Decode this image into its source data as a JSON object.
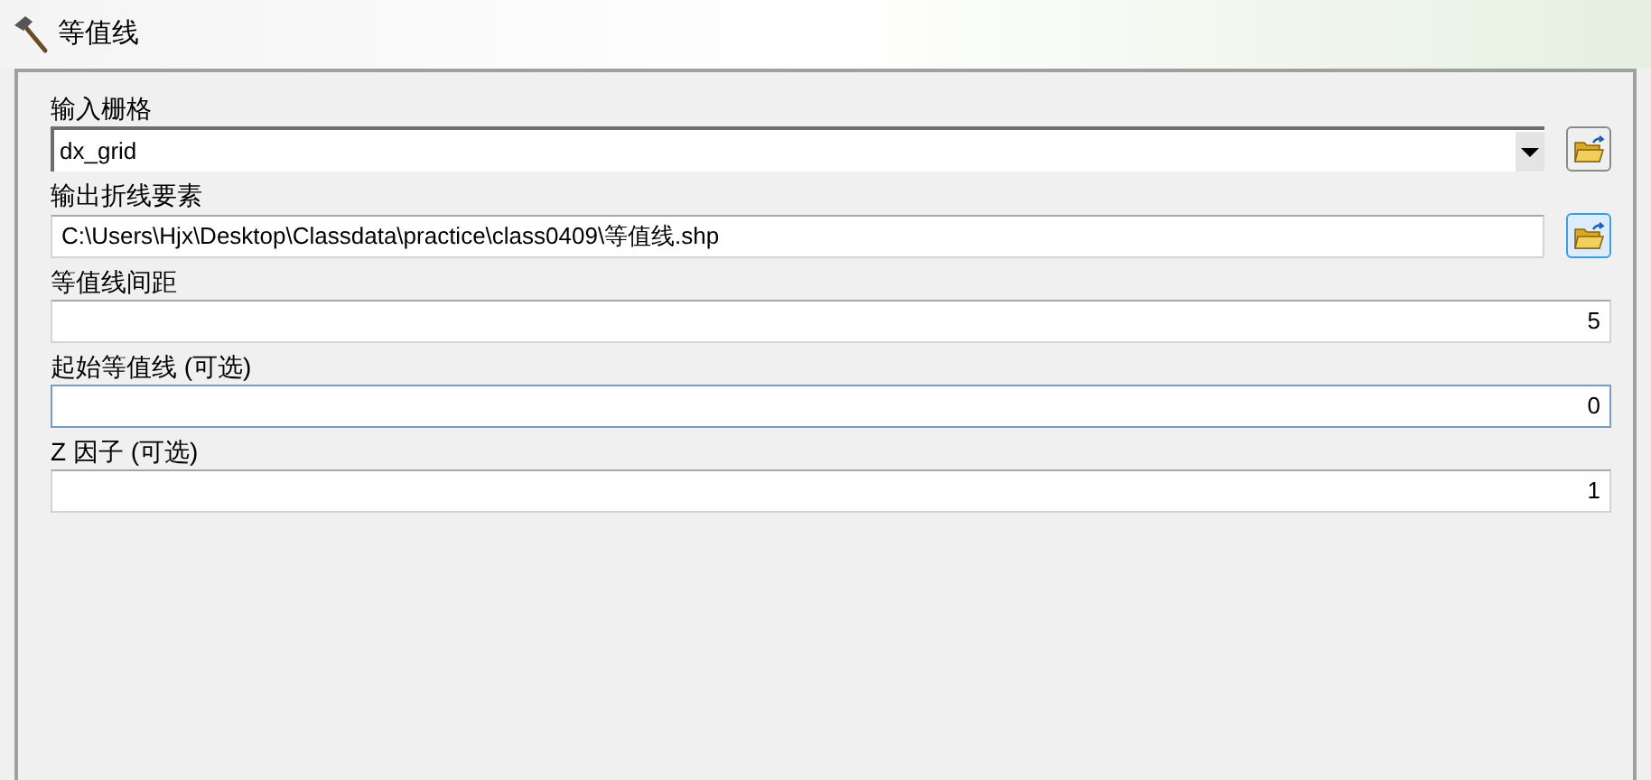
{
  "window": {
    "title": "等值线"
  },
  "fields": [
    {
      "label": "输入栅格",
      "value": "dx_grid",
      "kind": "dropdown"
    },
    {
      "label": "输出折线要素",
      "value": "C:\\Users\\Hjx\\Desktop\\Classdata\\practice\\class0409\\等值线.shp",
      "kind": "browse"
    },
    {
      "label": "等值线间距",
      "value": "5",
      "kind": "number",
      "focused": false
    },
    {
      "label": "起始等值线 (可选)",
      "value": "0",
      "kind": "number",
      "focused": true
    },
    {
      "label": "Z 因子 (可选)",
      "value": "1",
      "kind": "number",
      "focused": false
    }
  ]
}
